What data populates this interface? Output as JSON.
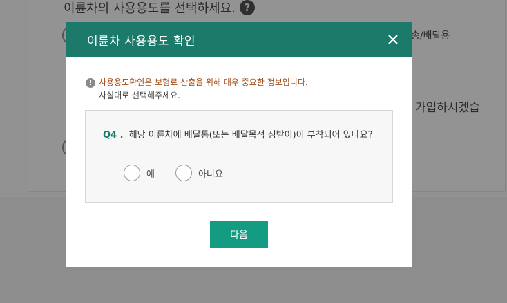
{
  "background": {
    "question_prefix": "이륜차의 사용용도를 선택하세요.",
    "help_icon": "?",
    "option_right": "송/배달용",
    "question2_tail": "가입하시겠습"
  },
  "modal": {
    "title": "이륜차 사용용도 확인",
    "notice_icon": "!",
    "notice_line1": "사용용도확인은 보험료 산출을 위해 매우 중요한 정보입니다.",
    "notice_line2": "사실대로 선택해주세요.",
    "question": {
      "number": "Q4 .",
      "text": "해당 이륜차에 배달통(또는 배달목적 짐받이)이 부착되어 있나요?",
      "options": [
        {
          "label": "예"
        },
        {
          "label": "아니요"
        }
      ]
    },
    "next_label": "다음"
  },
  "colors": {
    "header": "#1b7a69",
    "button": "#149c83",
    "notice_text": "#a24a12",
    "overlay": "#8d8d8d"
  },
  "icons": {
    "close": "close-icon",
    "notice": "exclamation-circle-icon",
    "help": "question-circle-icon"
  }
}
